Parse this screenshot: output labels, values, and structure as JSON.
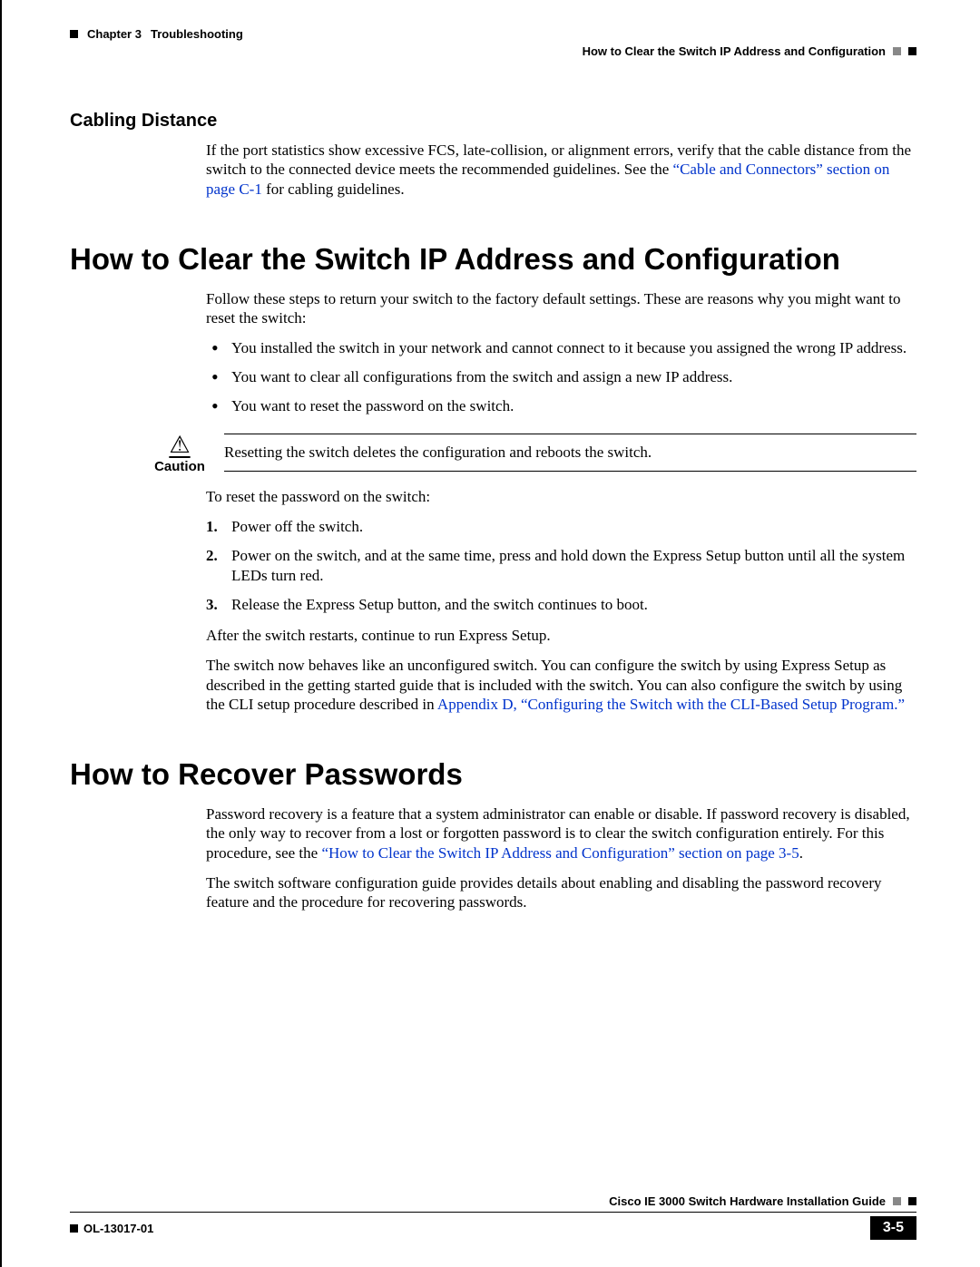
{
  "header": {
    "chapter": "Chapter 3",
    "title": "Troubleshooting",
    "section": "How to Clear the Switch IP Address and Configuration"
  },
  "cabling": {
    "heading": "Cabling Distance",
    "para_before_link": "If the port statistics show excessive FCS, late-collision, or alignment errors, verify that the cable distance from the switch to the connected device meets the recommended guidelines. See the ",
    "link": "“Cable and Connectors” section on page C-1",
    "para_after_link": " for cabling guidelines."
  },
  "clear_ip": {
    "heading": "How to Clear the Switch IP Address and Configuration",
    "intro": "Follow these steps to return your switch to the factory default settings. These are reasons why you might want to reset the switch:",
    "bullets": [
      "You installed the switch in your network and cannot connect to it because you assigned the wrong IP address.",
      "You want to clear all configurations from the switch and assign a new IP address.",
      "You want to reset the password on the switch."
    ],
    "caution_label": "Caution",
    "caution_text": "Resetting the switch deletes the configuration and reboots the switch.",
    "reset_intro": "To reset the password on the switch:",
    "steps": [
      "Power off the switch.",
      "Power on the switch, and at the same time, press and hold down the Express Setup button until all the system LEDs turn red.",
      "Release the Express Setup button, and the switch continues to boot."
    ],
    "after1": "After the switch restarts, continue to run Express Setup.",
    "after2_before": "The switch now behaves like an unconfigured switch. You can configure the switch by using Express Setup as described in the getting started guide that is included with the switch. You can also configure the switch by using the CLI setup procedure described in ",
    "after2_link": "Appendix D, “Configuring the Switch with the CLI-Based Setup Program.”"
  },
  "recover": {
    "heading": "How to Recover Passwords",
    "para1_before": "Password recovery is a feature that a system administrator can enable or disable. If password recovery is disabled, the only way to recover from a lost or forgotten password is to clear the switch configuration entirely. For this procedure, see the ",
    "para1_link": "“How to Clear the Switch IP Address and Configuration” section on page 3-5",
    "para1_after": ".",
    "para2": "The switch software configuration guide provides details about enabling and disabling the password recovery feature and the procedure for recovering passwords."
  },
  "footer": {
    "guide": "Cisco IE 3000 Switch Hardware Installation Guide",
    "docnum": "OL-13017-01",
    "page": "3-5"
  }
}
